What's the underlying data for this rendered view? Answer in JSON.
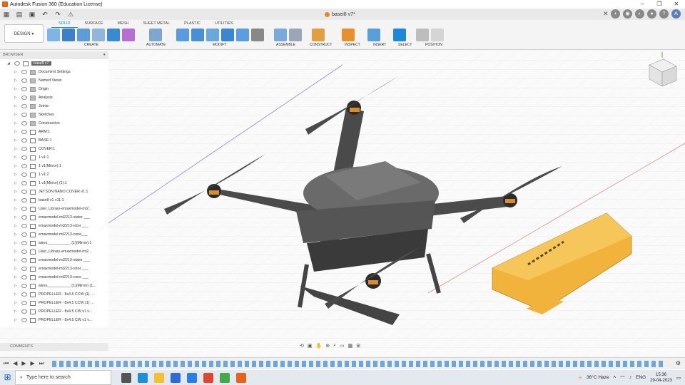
{
  "app": {
    "title": "Autodesk Fusion 360 (Education License)"
  },
  "document": {
    "tab_label": "basei8 v7*"
  },
  "ribbon": {
    "mode": "DESIGN",
    "tabs": [
      "SOLID",
      "SURFACE",
      "MESH",
      "SHEET METAL",
      "PLASTIC",
      "UTILITIES"
    ],
    "groups": [
      "CREATE",
      "AUTOMATE",
      "MODIFY",
      "ASSEMBLE",
      "CONSTRUCT",
      "INSPECT",
      "INSERT",
      "SELECT",
      "POSITION"
    ]
  },
  "browser": {
    "header": "BROWSER",
    "root": "base8 v7",
    "items": [
      "Document Settings",
      "Named Views",
      "Origin",
      "Analysis",
      "Joints",
      "Sketches",
      "Construction",
      "ARM:1",
      "BASE:1",
      "COVER:1",
      "1 v1:1",
      "1 v1(Mirror):1",
      "1 v1:2",
      "1 v1(Mirror) (1):1",
      "JETSON NANO COVER v1:1",
      "base8 v1 v11:1",
      "User_Library-emaxmodel-mt2...",
      "emaxmodel-mt2213-stator ___",
      "emaxmodel-mt2213-rotor ___",
      "emaxmodel-mt2213-cone___",
      "wires___________ (1)(Mirror):1",
      "User_Library-emaxmodel-mt2...",
      "emaxmodel-mt2213-stator ___",
      "emaxmodel-mt2213-rotor ___",
      "emaxmodel-mt2213-cone ___",
      "wires___________ (1)(Mirror) (1...",
      "PROPELLER - 8x4.5 CCW (1) ...",
      "PROPELLER - 8x4.5 CCW (1) ...",
      "PROPELLER - 8x4.5 CW v1 v...",
      "PROPELLER - 8x4.5 CW v1 v..."
    ]
  },
  "comments": {
    "label": "COMMENTS"
  },
  "taskbar": {
    "search_placeholder": "Type here to search",
    "weather": "36°C Haze",
    "lang": "ENG",
    "time": "15:36",
    "date": "29-04-2023"
  },
  "colors": {
    "accent": "#0696d7",
    "drone": "#3a3a3a",
    "cover": "#f2b33d"
  }
}
